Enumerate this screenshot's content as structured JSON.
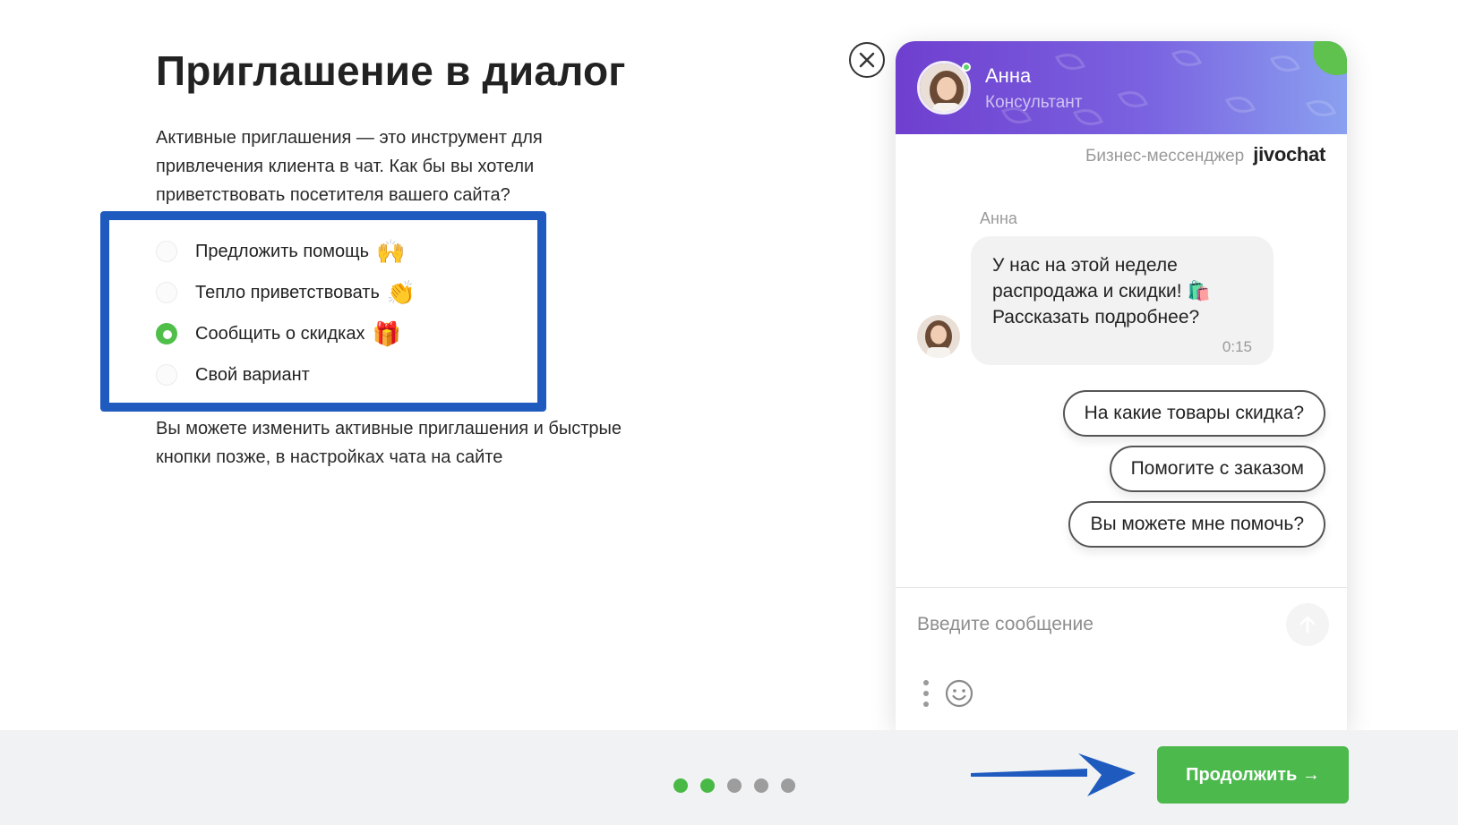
{
  "main": {
    "title": "Приглашение в диалог",
    "intro": "Активные приглашения — это инструмент для привлечения клиента в чат. Как бы вы хотели приветствовать посетителя вашего сайта?",
    "options": [
      {
        "label": "Предложить помощь",
        "emoji": "🙌",
        "checked": false
      },
      {
        "label": "Тепло приветствовать",
        "emoji": "👏",
        "checked": false
      },
      {
        "label": "Сообщить о скидках",
        "emoji": "🎁",
        "checked": true
      },
      {
        "label": "Свой вариант",
        "emoji": "",
        "checked": false
      }
    ],
    "note": "Вы можете изменить активные приглашения и быстрые кнопки позже, в настройках чата на сайте"
  },
  "chat": {
    "agent_name": "Анна",
    "agent_role": "Консультант",
    "brand_text": "Бизнес-мессенджер",
    "brand_logo": "jivochat",
    "message": {
      "sender": "Анна",
      "lines": [
        "У нас на этой неделе",
        "распродажа и скидки! 🛍️",
        "Рассказать подробнее?"
      ],
      "time": "0:15"
    },
    "quick_replies": [
      "На какие товары скидка?",
      "Помогите с заказом",
      "Вы можете мне помочь?"
    ],
    "input_placeholder": "Введите сообщение"
  },
  "footer": {
    "dots_total": 5,
    "dots_active": 2,
    "continue_label": "Продолжить →"
  },
  "colors": {
    "accent_green": "#4cb94d",
    "highlight_blue": "#1f5bbf",
    "header_purple": "#6f3fcf"
  },
  "icons": [
    "close-icon",
    "send-icon",
    "more-vertical-icon",
    "smile-icon",
    "annotation-arrow-icon"
  ]
}
